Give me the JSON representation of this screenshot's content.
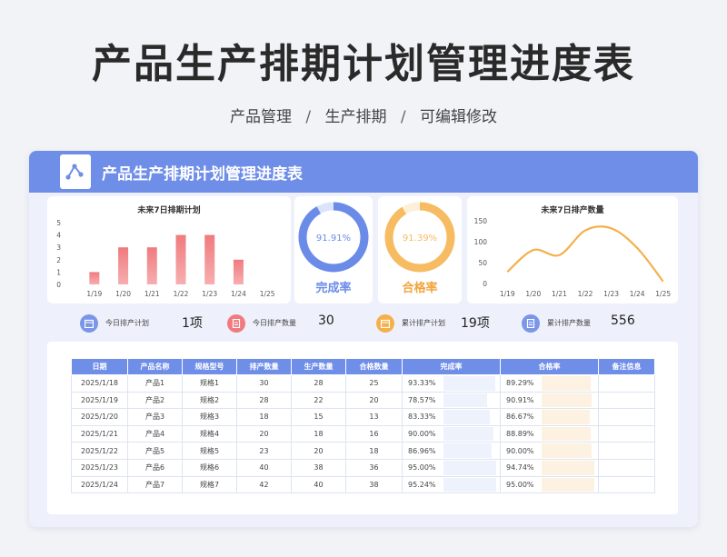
{
  "main_title": "产品生产排期计划管理进度表",
  "breadcrumb": [
    "产品管理",
    "生产排期",
    "可编辑修改"
  ],
  "breadcrumb_sep": "/",
  "card_title": "产品生产排期计划管理进度表",
  "colors": {
    "accent": "#6f8ee8",
    "bar": "#ef7b7e",
    "line": "#f5b04c",
    "donut_blue": "#6b8be8",
    "donut_orange": "#f7bb62",
    "rate_bar_blue": "#edf2fd",
    "rate_bar_orange": "#fdf1e1"
  },
  "chart_data": [
    {
      "type": "bar",
      "title": "未来7日排期计划",
      "categories": [
        "1/19",
        "1/20",
        "1/21",
        "1/22",
        "1/23",
        "1/24",
        "1/25"
      ],
      "values": [
        1,
        3,
        3,
        4,
        4,
        2,
        0
      ],
      "ylim": [
        0,
        5
      ],
      "yticks": [
        0,
        1,
        2,
        3,
        4,
        5
      ],
      "grid": false
    },
    {
      "type": "line",
      "title": "未来7日排产数量",
      "categories": [
        "1/19",
        "1/20",
        "1/21",
        "1/22",
        "1/23",
        "1/24",
        "1/25"
      ],
      "values": [
        28,
        80,
        68,
        127,
        132,
        85,
        5
      ],
      "ylim": [
        0,
        150
      ],
      "yticks": [
        0,
        50,
        100,
        150
      ],
      "grid": false
    },
    {
      "type": "pie",
      "label": "完成率",
      "value_text": "91.91%",
      "value": 91.91
    },
    {
      "type": "pie",
      "label": "合格率",
      "value_text": "91.39%",
      "value": 91.39
    }
  ],
  "stats": [
    {
      "label": "今日排产计划",
      "value": "1项",
      "icon": "calendar-icon",
      "color": "#7b96e8"
    },
    {
      "label": "今日排产数量",
      "value": "30",
      "icon": "document-icon",
      "color": "#ef7b7e"
    },
    {
      "label": "累计排产计划",
      "value": "19项",
      "icon": "calendar-icon",
      "color": "#f5b04c"
    },
    {
      "label": "累计排产数量",
      "value": "556",
      "icon": "document-icon",
      "color": "#7b96e8"
    }
  ],
  "table": {
    "headers": [
      "日期",
      "产品名称",
      "规格型号",
      "排产数量",
      "生产数量",
      "合格数量",
      "完成率",
      "合格率",
      "备注信息"
    ],
    "rows": [
      {
        "date": "2025/1/18",
        "product": "产品1",
        "spec": "规格1",
        "plan": "30",
        "produced": "28",
        "qualified": "25",
        "done_rate": "93.33%",
        "done": 93.33,
        "pass_rate": "89.29%",
        "pass": 89.29,
        "note": ""
      },
      {
        "date": "2025/1/19",
        "product": "产品2",
        "spec": "规格2",
        "plan": "28",
        "produced": "22",
        "qualified": "20",
        "done_rate": "78.57%",
        "done": 78.57,
        "pass_rate": "90.91%",
        "pass": 90.91,
        "note": ""
      },
      {
        "date": "2025/1/20",
        "product": "产品3",
        "spec": "规格3",
        "plan": "18",
        "produced": "15",
        "qualified": "13",
        "done_rate": "83.33%",
        "done": 83.33,
        "pass_rate": "86.67%",
        "pass": 86.67,
        "note": ""
      },
      {
        "date": "2025/1/21",
        "product": "产品4",
        "spec": "规格4",
        "plan": "20",
        "produced": "18",
        "qualified": "16",
        "done_rate": "90.00%",
        "done": 90.0,
        "pass_rate": "88.89%",
        "pass": 88.89,
        "note": ""
      },
      {
        "date": "2025/1/22",
        "product": "产品5",
        "spec": "规格5",
        "plan": "23",
        "produced": "20",
        "qualified": "18",
        "done_rate": "86.96%",
        "done": 86.96,
        "pass_rate": "90.00%",
        "pass": 90.0,
        "note": ""
      },
      {
        "date": "2025/1/23",
        "product": "产品6",
        "spec": "规格6",
        "plan": "40",
        "produced": "38",
        "qualified": "36",
        "done_rate": "95.00%",
        "done": 95.0,
        "pass_rate": "94.74%",
        "pass": 94.74,
        "note": ""
      },
      {
        "date": "2025/1/24",
        "product": "产品7",
        "spec": "规格7",
        "plan": "42",
        "produced": "40",
        "qualified": "38",
        "done_rate": "95.24%",
        "done": 95.24,
        "pass_rate": "95.00%",
        "pass": 95.0,
        "note": ""
      }
    ]
  }
}
